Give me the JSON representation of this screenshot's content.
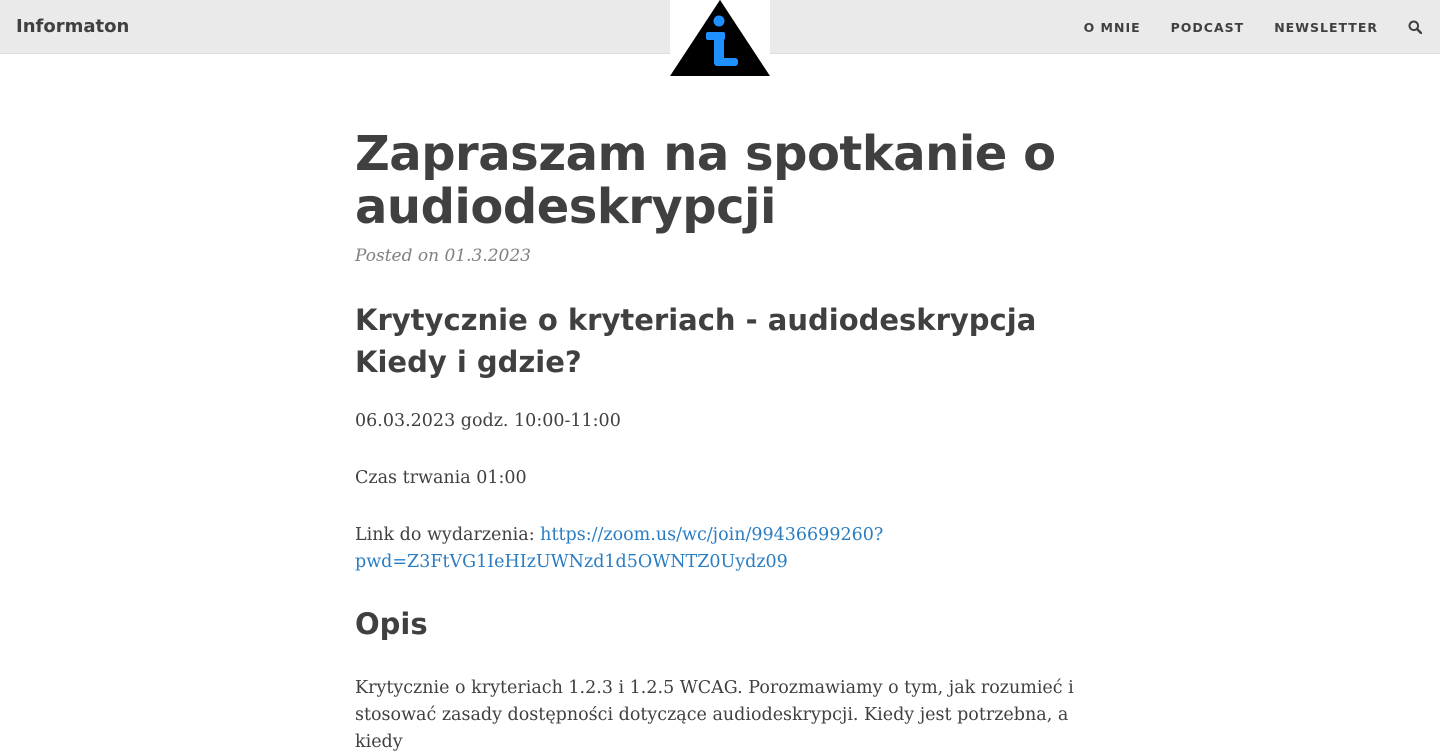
{
  "navbar": {
    "brand": "Informaton",
    "links": [
      "O MNIE",
      "PODCAST",
      "NEWSLETTER"
    ]
  },
  "post": {
    "title": "Zapraszam na spotkanie o audiodeskrypcji",
    "meta": "Posted on 01.3.2023",
    "heading1": "Krytycznie o kryteriach - audiodeskrypcja",
    "heading2": "Kiedy i gdzie?",
    "date_line": "06.03.2023 godz. 10:00-11:00",
    "duration_line": "Czas trwania 01:00",
    "link_label": "Link do wydarzenia: ",
    "link_line1": "https://zoom.us/wc/join/99436699260?",
    "link_line2": "pwd=Z3FtVG1IeHIzUWNzd1d5OWNTZ0Uydz09",
    "opis_heading": "Opis",
    "desc_line1": "Krytycznie o kryteriach 1.2.3 i 1.2.5 WCAG. Porozmawiamy o tym, jak rozumieć i",
    "desc_line2": "stosować zasady dostępności dotyczące audiodeskrypcji. Kiedy jest potrzebna, a kiedy"
  },
  "icons": {
    "logo": "info-triangle-logo",
    "search": "search-icon"
  },
  "colors": {
    "navbar_bg": "#eaeaea",
    "text": "#404040",
    "meta": "#808080",
    "link": "#2a7dc3",
    "logo_blue": "#1e90ff"
  }
}
